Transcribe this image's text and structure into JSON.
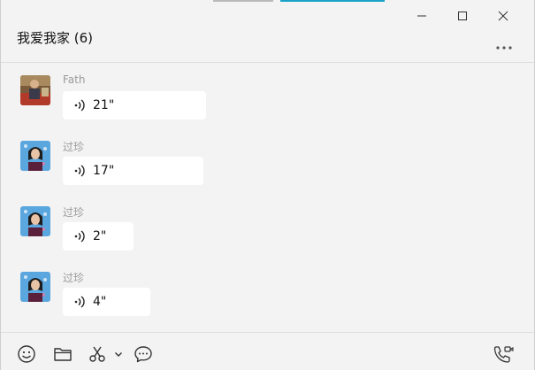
{
  "window": {
    "title": "我爱我家 (6)",
    "controls": [
      "minimize-icon",
      "maximize-icon",
      "close-icon"
    ],
    "more": "more-icon"
  },
  "messages": [
    {
      "sender": "Fath",
      "duration": "21\"",
      "icon": "voice-icon",
      "avatar": "avatar-photo-fath"
    },
    {
      "sender": "过珍",
      "duration": "17\"",
      "icon": "voice-icon",
      "avatar": "avatar-photo-guozhen"
    },
    {
      "sender": "过珍",
      "duration": "2\"",
      "icon": "voice-icon",
      "avatar": "avatar-photo-guozhen"
    },
    {
      "sender": "过珍",
      "duration": "4\"",
      "icon": "voice-icon",
      "avatar": "avatar-photo-guozhen"
    }
  ],
  "toolbar": {
    "items": [
      "emoji-icon",
      "folder-icon",
      "scissors-icon",
      "chevron-down-icon",
      "chat-bubble-icon",
      "video-call-icon"
    ]
  },
  "colors": {
    "background": "#f3f3f3",
    "bubble": "#ffffff",
    "sender_text": "#9a9a9a",
    "accent_strip": "#1aa3c9"
  }
}
